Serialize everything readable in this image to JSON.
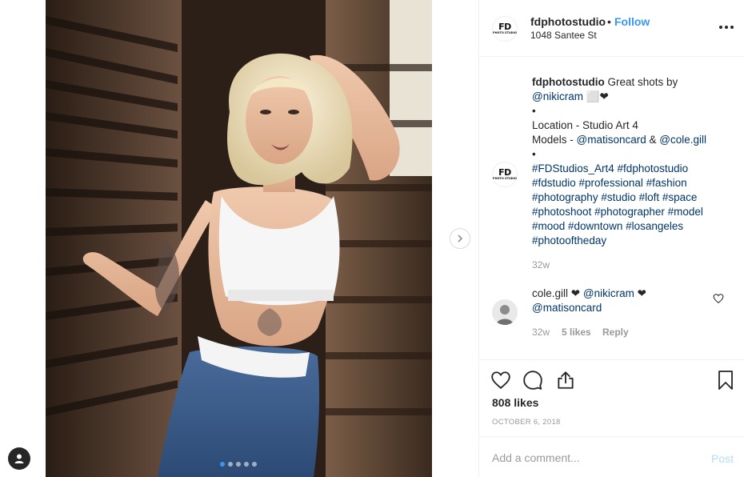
{
  "post": {
    "username": "fdphotostudio",
    "separator": "•",
    "follow_label": "Follow",
    "location": "1048 Santee St",
    "avatar_logo_text": "FD",
    "avatar_logo_subtext": "PHOTO STUDIO"
  },
  "caption": {
    "username": "fdphotostudio",
    "line1_text": " Great shots by",
    "line2_mention": "@nikicram",
    "line2_suffix": " ⬜❤",
    "bullet": "•",
    "location_line": "Location - Studio Art 4",
    "models_prefix": "Models - ",
    "model1": "@matisoncard",
    "models_amp": " & ",
    "model2": "@cole.gill",
    "hashtag_lines": [
      "#FDStudios_Art4 #fdphotostudio",
      "#fdstudio #professional #fashion",
      "#photography #studio #loft #space",
      "#photoshoot #photographer #model",
      "#mood #downtown #losangeles",
      "#photooftheday"
    ],
    "time": "32w"
  },
  "comment": {
    "username": "cole.gill",
    "text_prefix": " ❤ ",
    "mention1": "@nikicram",
    "text_mid": " ❤",
    "mention2": "@matisoncard",
    "time": "32w",
    "likes": "5 likes",
    "reply_label": "Reply"
  },
  "actions": {
    "likes_count": "808 likes",
    "date": "OCTOBER 6, 2018"
  },
  "add_comment": {
    "placeholder": "Add a comment...",
    "post_label": "Post"
  },
  "carousel": {
    "slide_count": 5,
    "active_slide": 1
  },
  "colors": {
    "link_blue": "#3897f0",
    "mention_blue": "#003569",
    "muted_gray": "#999999",
    "post_disabled": "#b3dbff"
  }
}
